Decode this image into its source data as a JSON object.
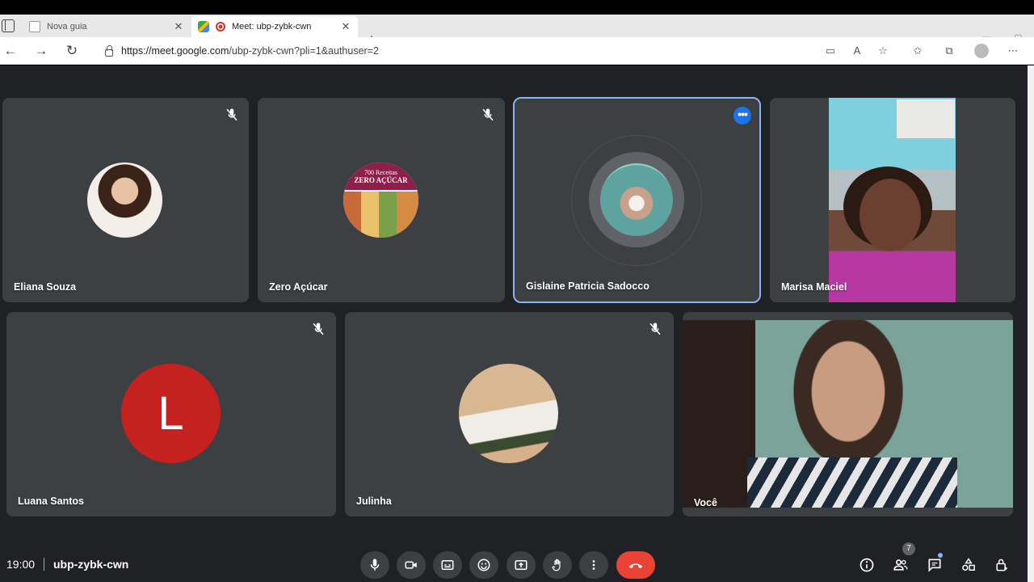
{
  "browser": {
    "tabs": [
      {
        "title": "Nova guia",
        "active": false
      },
      {
        "title": "Meet: ubp-zybk-cwn",
        "active": true
      }
    ],
    "url_host": "https://meet.google.com",
    "url_path": "/ubp-zybk-cwn?pli=1&authuser=2"
  },
  "participants": [
    {
      "name": "Eliana Souza",
      "muted": true,
      "kind": "photo-avatar"
    },
    {
      "name": "Zero Açúcar",
      "muted": true,
      "kind": "photo-avatar",
      "avatar_text_1": "700 Receitas",
      "avatar_text_2": "ZERO AÇÚCAR"
    },
    {
      "name": "Gislaine Patricia Sadocco",
      "muted": false,
      "speaking": true,
      "kind": "photo-avatar"
    },
    {
      "name": "Marisa Maciel",
      "muted": false,
      "kind": "video"
    },
    {
      "name": "Luana Santos",
      "muted": true,
      "kind": "letter-avatar",
      "initial": "L"
    },
    {
      "name": "Julinha",
      "muted": true,
      "kind": "photo-avatar"
    },
    {
      "name": "Você",
      "muted": false,
      "kind": "video"
    }
  ],
  "footer": {
    "time": "19:00",
    "meeting_code": "ubp-zybk-cwn",
    "people_count": "7"
  },
  "colors": {
    "meet_bg": "#202124",
    "tile_bg": "#3c4043",
    "speaking_outline": "#8ab4f8",
    "end_call": "#ea4335",
    "letter_avatar": "#c5221f"
  }
}
